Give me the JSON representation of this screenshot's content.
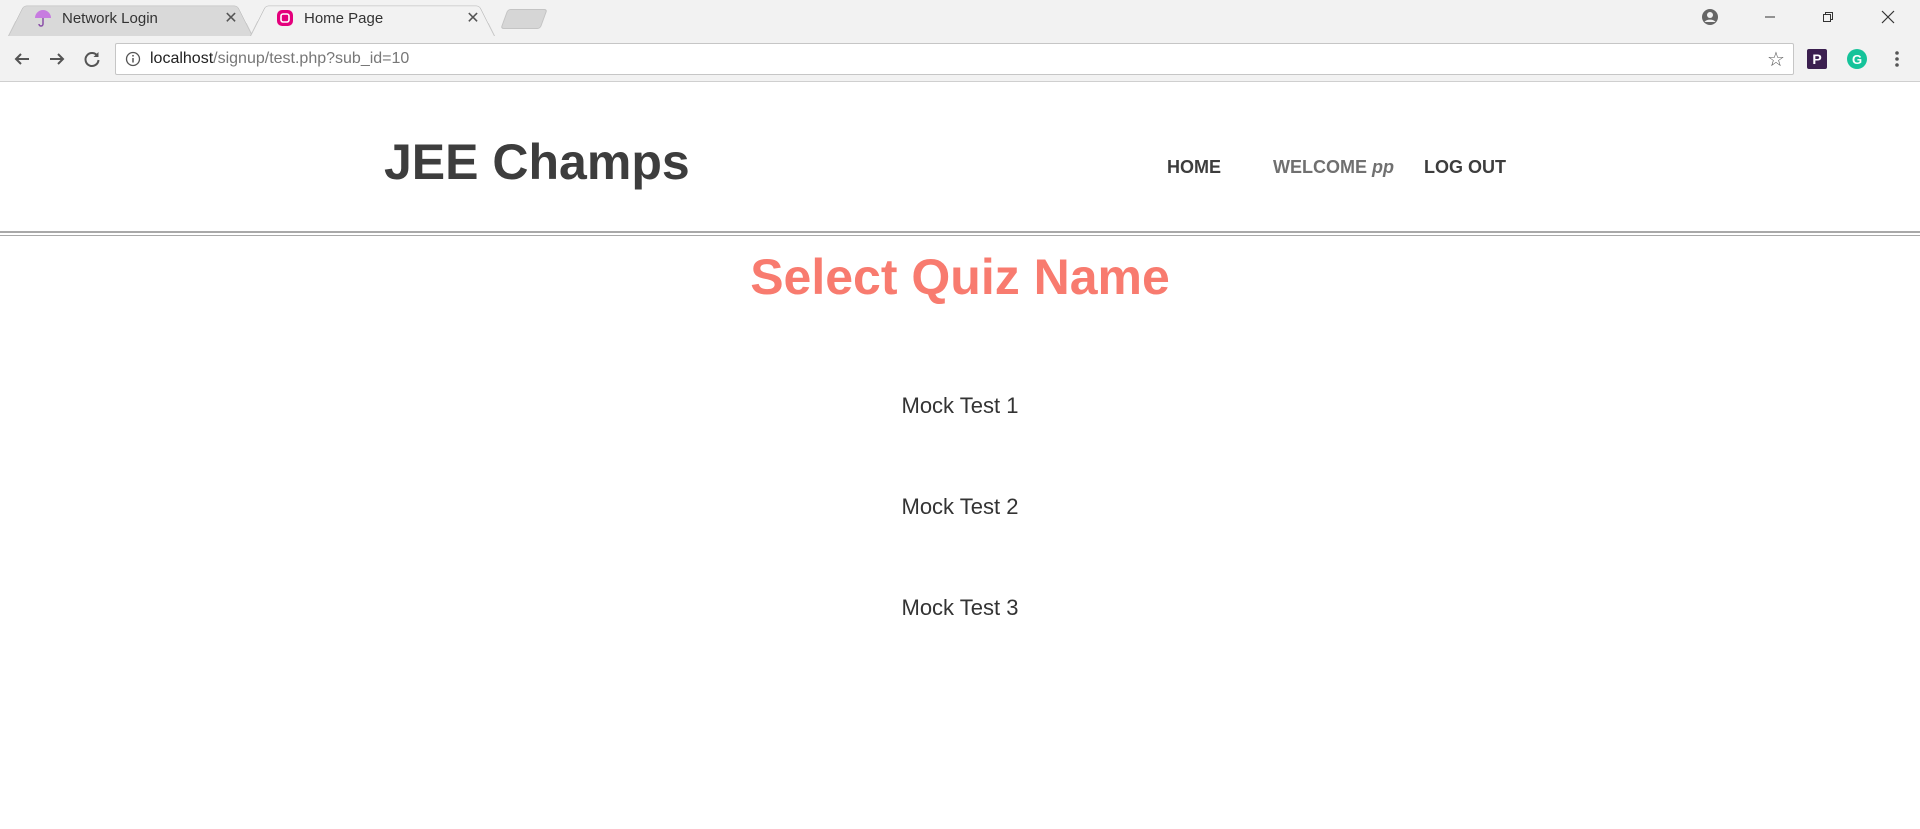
{
  "browser": {
    "tabs": [
      {
        "label": "Network Login",
        "icon": "umbrella-icon",
        "active": false
      },
      {
        "label": "Home Page",
        "icon": "wamp-icon",
        "active": true
      }
    ],
    "url_host": "localhost",
    "url_path": "/signup/test.php?sub_id=10",
    "extensions": [
      "p-extension-icon",
      "grammarly-icon"
    ]
  },
  "header": {
    "brand": "JEE Champs",
    "nav": {
      "home": "HOME",
      "welcome_prefix": "WELCOME",
      "username": "pp",
      "logout": "LOG OUT"
    }
  },
  "main": {
    "title": "Select Quiz Name",
    "quizzes": [
      "Mock Test 1",
      "Mock Test 2",
      "Mock Test 3"
    ]
  },
  "colors": {
    "title": "#f87b6f",
    "text": "#3d3d3d"
  }
}
